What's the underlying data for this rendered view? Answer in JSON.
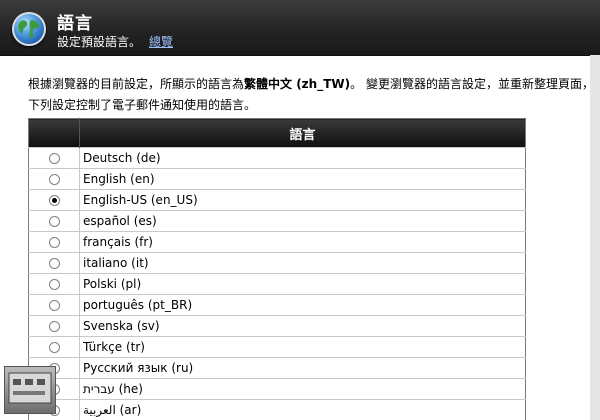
{
  "header": {
    "title": "語言",
    "subtitle": "設定預設語言。",
    "overview_link": "總覽"
  },
  "description": {
    "line1_prefix": "根據瀏覽器的目前設定，所顯示的語言為",
    "current_language": "繁體中文 (zh_TW)",
    "line1_suffix": "。 變更瀏覽器的語言設定，並重新整理頁面，以",
    "line2": "下列設定控制了電子郵件通知使用的語言。"
  },
  "table": {
    "header_language": "語言",
    "rows": [
      {
        "label": "Deutsch (de)",
        "selected": false
      },
      {
        "label": "English (en)",
        "selected": false
      },
      {
        "label": "English-US (en_US)",
        "selected": true
      },
      {
        "label": "español (es)",
        "selected": false
      },
      {
        "label": "français (fr)",
        "selected": false
      },
      {
        "label": "italiano (it)",
        "selected": false
      },
      {
        "label": "Polski (pl)",
        "selected": false
      },
      {
        "label": "português (pt_BR)",
        "selected": false
      },
      {
        "label": "Svenska (sv)",
        "selected": false
      },
      {
        "label": "Türkçe (tr)",
        "selected": false
      },
      {
        "label": "Русский язык (ru)",
        "selected": false
      },
      {
        "label": "עברית (he)",
        "selected": false
      },
      {
        "label": "العربية (ar)",
        "selected": false
      }
    ]
  },
  "colors": {
    "header_bg": "#222222",
    "link": "#9fc3ff",
    "table_header_bg": "#0e0e0e"
  },
  "icons": {
    "header_icon": "globe-icon",
    "radio": "radio-button"
  }
}
